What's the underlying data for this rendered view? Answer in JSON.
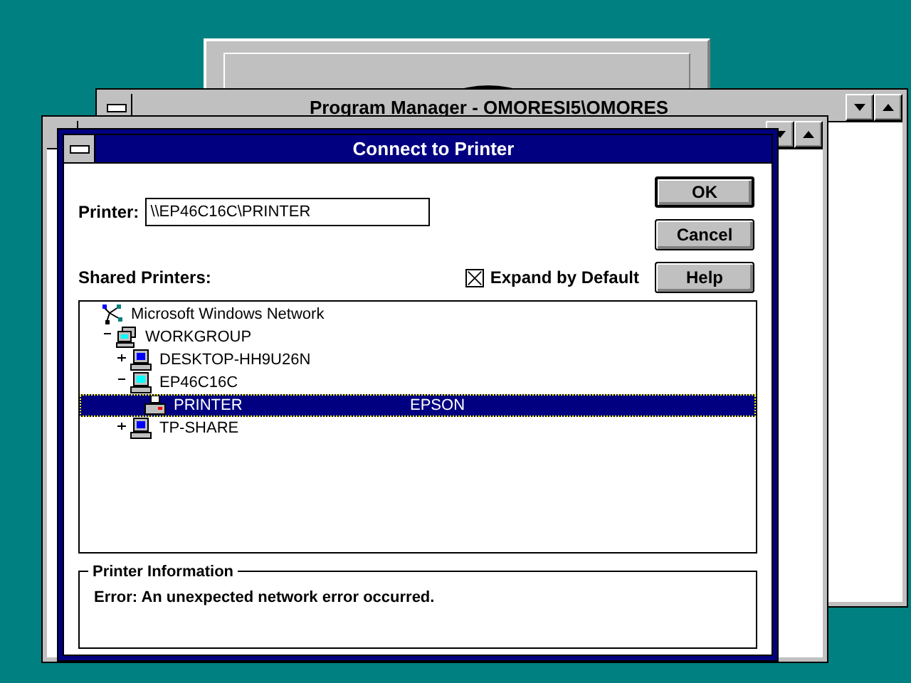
{
  "program_manager": {
    "title": "Program Manager - OMORESI5\\OMORES"
  },
  "dialog": {
    "title": "Connect to Printer",
    "printer_field": {
      "label": "Printer:",
      "value": "\\\\EP46C16C\\PRINTER"
    },
    "shared_label": "Shared Printers:",
    "expand_checkbox": {
      "label": "Expand by Default",
      "checked": true
    },
    "buttons": [
      {
        "label": "OK",
        "default": true
      },
      {
        "label": "Cancel",
        "default": false
      },
      {
        "label": "Help",
        "default": false
      }
    ],
    "tree": [
      {
        "kind": "network",
        "label": "Microsoft Windows Network",
        "selected": false,
        "children": [
          {
            "kind": "workgroup",
            "label": "WORKGROUP",
            "expanded": true,
            "selected": false,
            "children": [
              {
                "kind": "computer",
                "label": "DESKTOP-HH9U26N",
                "expanded": false,
                "selected": false
              },
              {
                "kind": "computer",
                "label": "EP46C16C",
                "expanded": true,
                "selected": false,
                "children": [
                  {
                    "kind": "printer",
                    "label": "PRINTER",
                    "description": "EPSON",
                    "selected": true
                  }
                ]
              },
              {
                "kind": "computer",
                "label": "TP-SHARE",
                "expanded": false,
                "selected": false
              }
            ]
          }
        ]
      }
    ],
    "info": {
      "legend": "Printer Information",
      "text": "Error: An unexpected network error occurred."
    }
  }
}
